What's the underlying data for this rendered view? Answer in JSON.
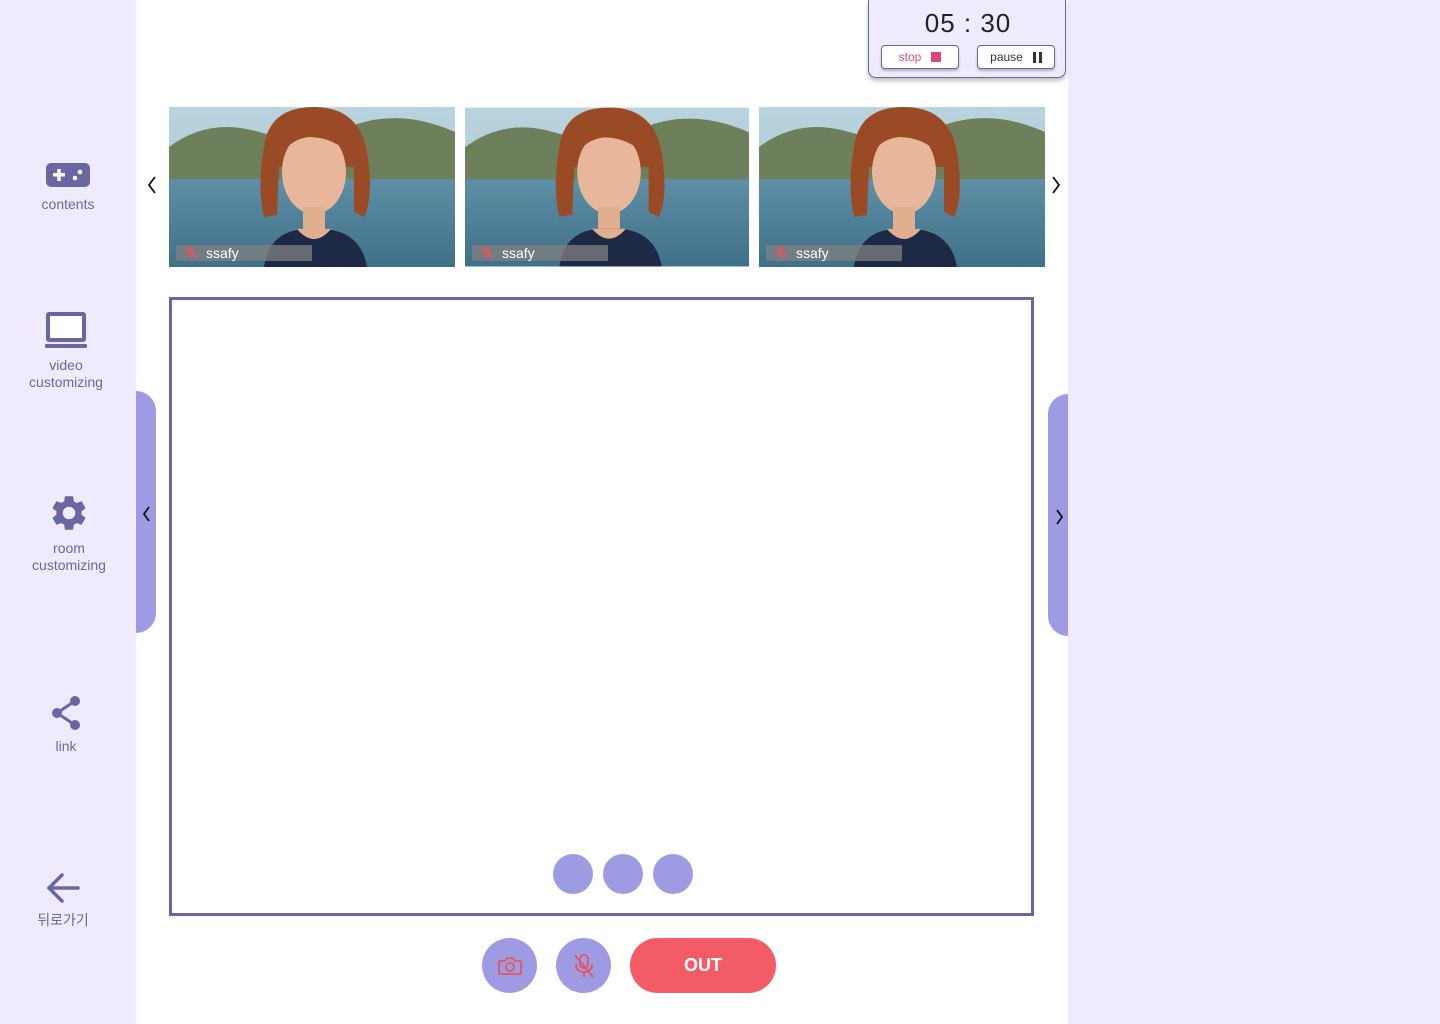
{
  "sidebar": {
    "items": [
      {
        "id": "contents",
        "label": "contents",
        "icon": "gamepad-icon"
      },
      {
        "id": "video",
        "label_line1": "video",
        "label_line2": "customizing",
        "icon": "laptop-icon"
      },
      {
        "id": "room",
        "label_line1": "room",
        "label_line2": "customizing",
        "icon": "gear-icon"
      },
      {
        "id": "link",
        "label": "link",
        "icon": "share-icon"
      },
      {
        "id": "back",
        "label": "뒤로가기",
        "icon": "arrow-left-icon"
      }
    ]
  },
  "timer": {
    "time": "05 : 30",
    "stop_label": "stop",
    "pause_label": "pause"
  },
  "participants": [
    {
      "name": "ssafy",
      "muted": true
    },
    {
      "name": "ssafy",
      "muted": true
    },
    {
      "name": "ssafy",
      "muted": true
    }
  ],
  "controls": {
    "out_label": "OUT"
  },
  "colors": {
    "accent": "#6A66A3",
    "accent_light": "#9F9BE3",
    "background": "#EFEBFD",
    "out": "#F35B66",
    "stop": "#E0457C"
  }
}
